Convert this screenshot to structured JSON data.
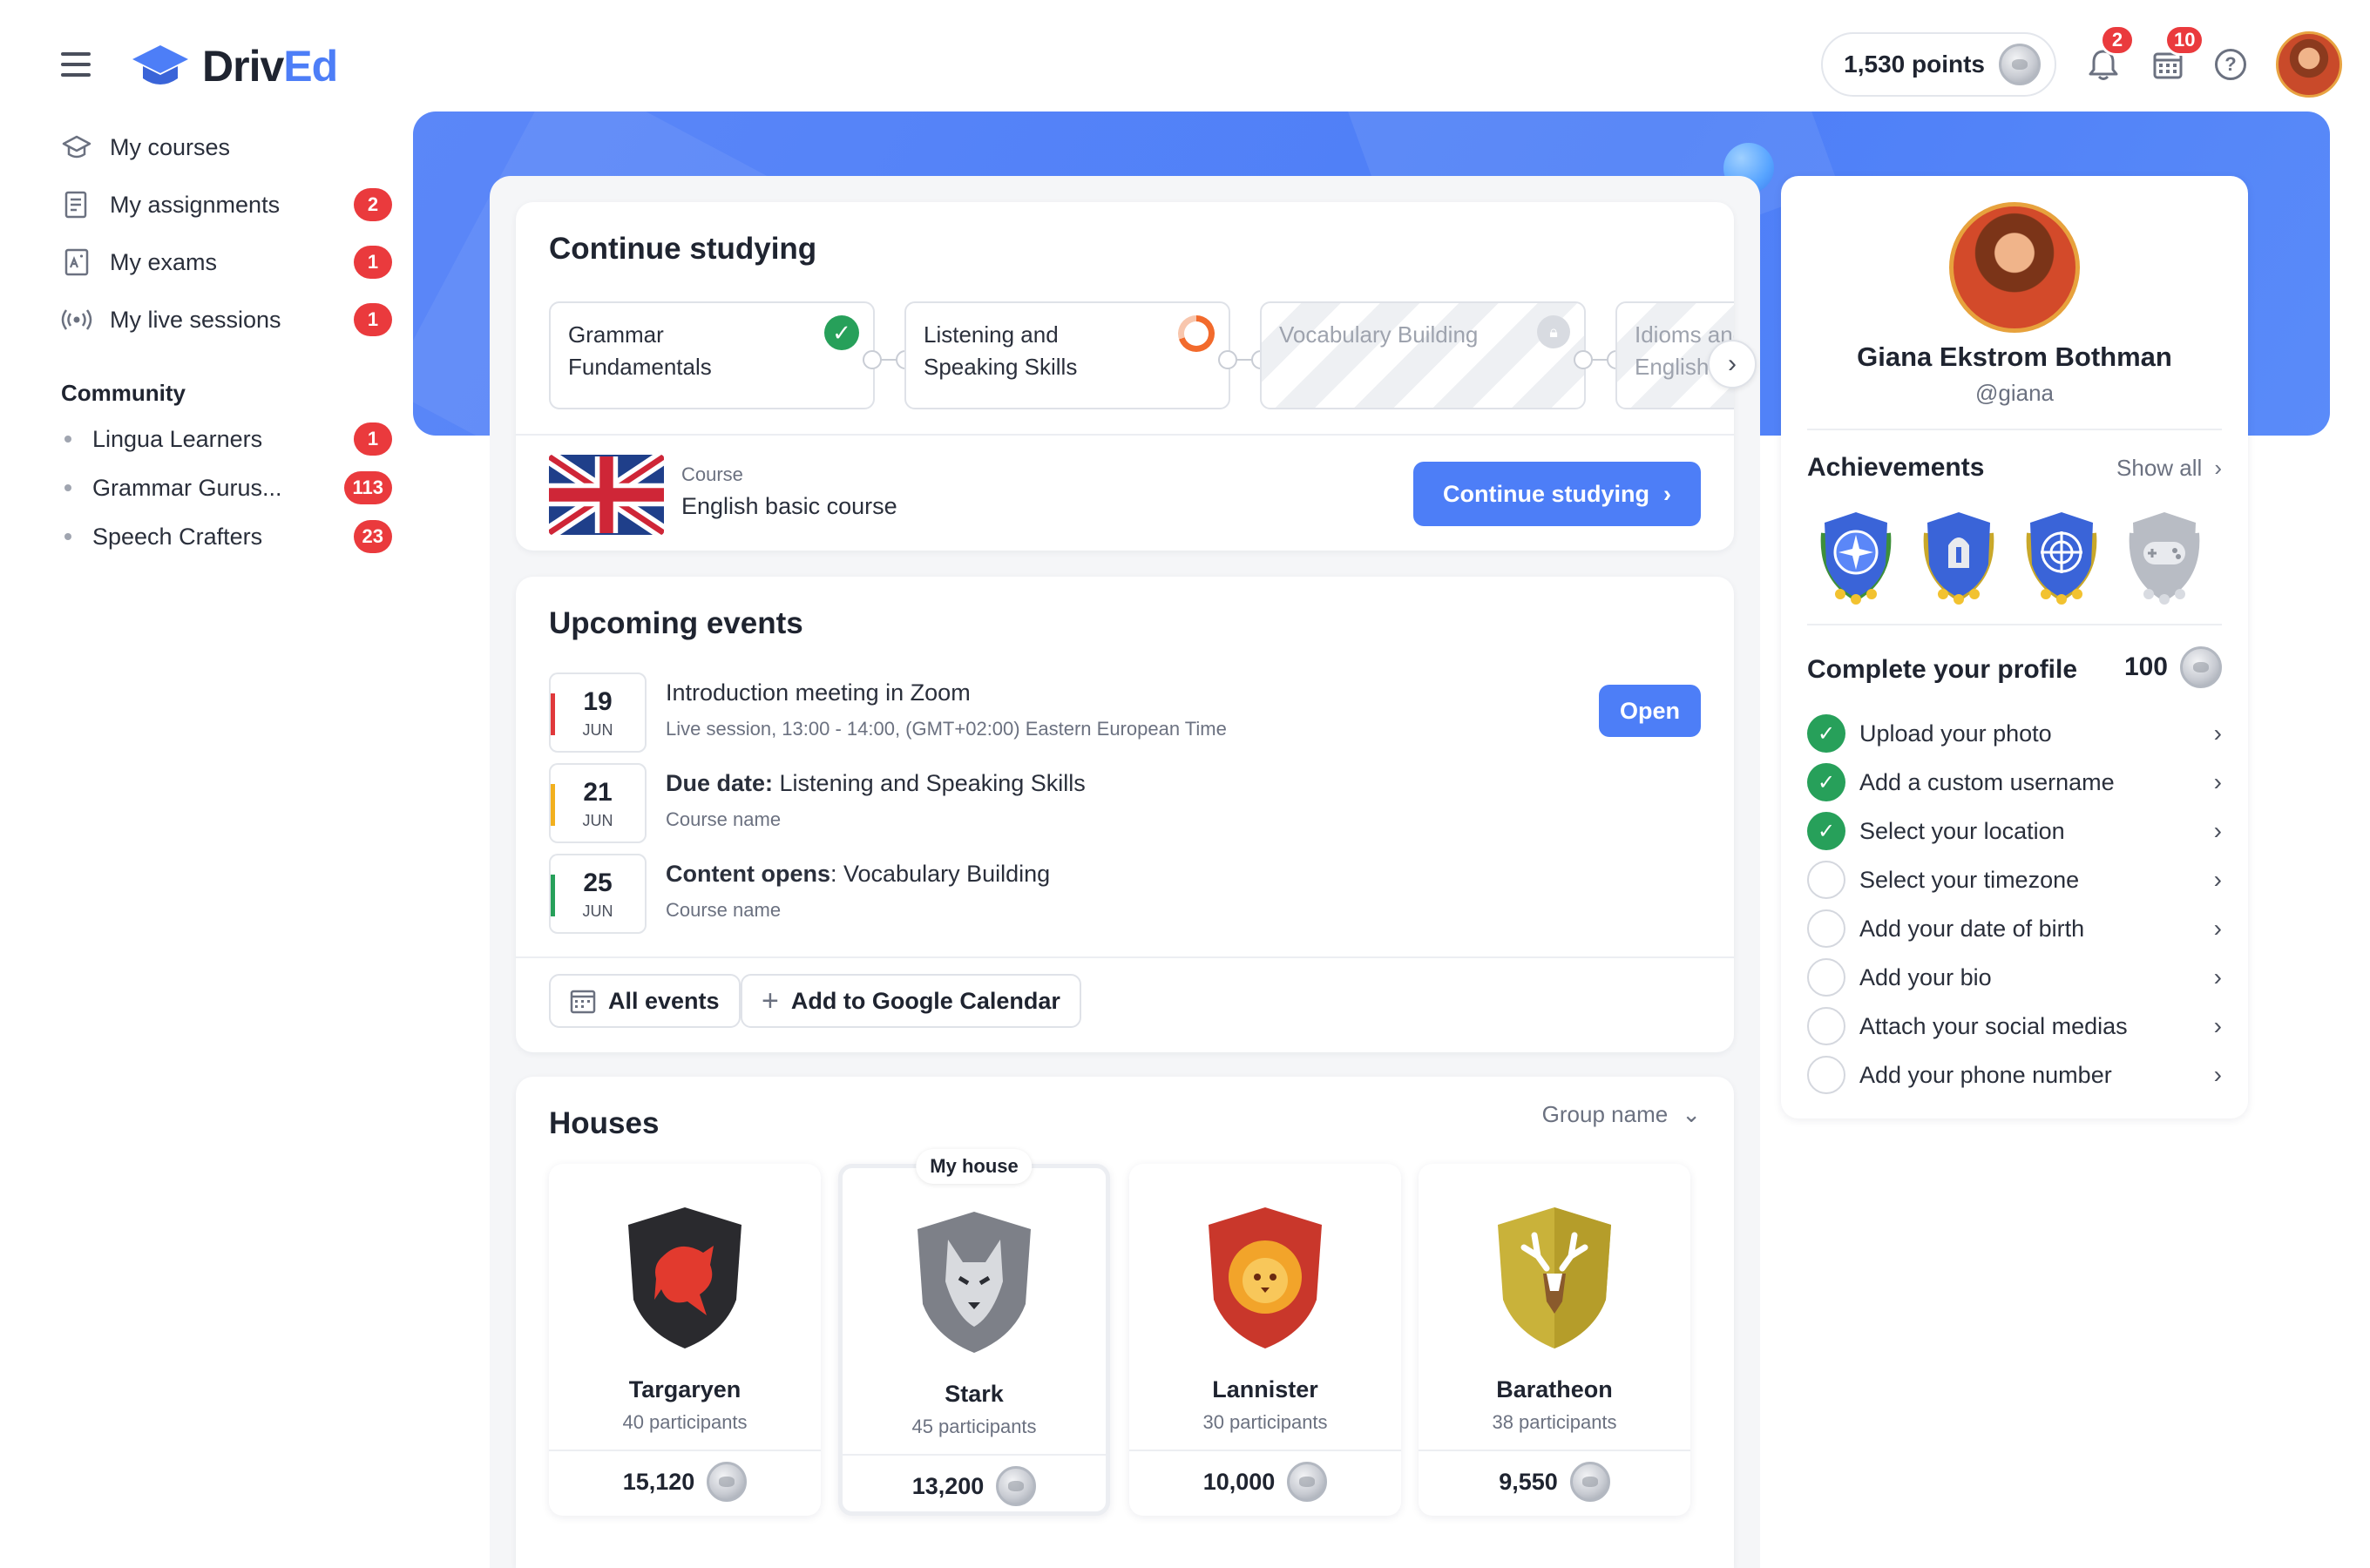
{
  "brand": {
    "name_part1": "Driv",
    "name_part2": "Ed",
    "accent_color": "#4d7ef7"
  },
  "topbar": {
    "points": "1,530 points",
    "notifications_count": "2",
    "calendar_count": "10",
    "help_symbol": "?"
  },
  "sidebar": {
    "items": [
      {
        "label": "My courses",
        "icon": "graduation-cap-icon",
        "badge": ""
      },
      {
        "label": "My assignments",
        "icon": "assignment-icon",
        "badge": "2"
      },
      {
        "label": "My exams",
        "icon": "exam-icon",
        "badge": "1"
      },
      {
        "label": "My live sessions",
        "icon": "live-broadcast-icon",
        "badge": "1"
      }
    ],
    "community_title": "Community",
    "community": [
      {
        "label": "Lingua Learners",
        "badge": "1"
      },
      {
        "label": "Grammar Gurus...",
        "badge": "113"
      },
      {
        "label": "Speech Crafters",
        "badge": "23"
      }
    ]
  },
  "continue_studying": {
    "title": "Continue studying",
    "lessons": [
      {
        "label": "Grammar Fundamentals",
        "status": "completed"
      },
      {
        "label": "Listening and Speaking Skills",
        "status": "in-progress"
      },
      {
        "label": "Vocabulary Building",
        "status": "locked"
      },
      {
        "label": "Idioms and Phrases in English",
        "status": "locked"
      }
    ],
    "course_label": "Course",
    "course_name": "English basic course",
    "button": "Continue studying"
  },
  "events": {
    "title": "Upcoming events",
    "items": [
      {
        "day": "19",
        "month": "JUN",
        "title_bold": "",
        "title": "Introduction meeting in Zoom",
        "subtitle": "Live session, 13:00 - 14:00, (GMT+02:00) Eastern European Time",
        "stripe": "#e0393b",
        "action": "Open"
      },
      {
        "day": "21",
        "month": "JUN",
        "title_bold": "Due date:",
        "title": " Listening and Speaking Skills",
        "subtitle": "Course name",
        "stripe": "#f2b01e",
        "action": ""
      },
      {
        "day": "25",
        "month": "JUN",
        "title_bold": "Content opens",
        "title": ": Vocabulary Building",
        "subtitle": "Course name",
        "stripe": "#27a05a",
        "action": ""
      }
    ],
    "all_events": "All events",
    "add_calendar": "Add to Google Calendar"
  },
  "houses": {
    "title": "Houses",
    "group_select": "Group name",
    "my_house_tag": "My house",
    "items": [
      {
        "name": "Targaryen",
        "participants": "40 participants",
        "score": "15,120",
        "mine": false,
        "color": "#2a2a2e",
        "emblem": "#e23a2e"
      },
      {
        "name": "Stark",
        "participants": "45 participants",
        "score": "13,200",
        "mine": true,
        "color": "#7d8088",
        "emblem": "#d8dade"
      },
      {
        "name": "Lannister",
        "participants": "30 participants",
        "score": "10,000",
        "mine": false,
        "color": "#c9372b",
        "emblem": "#f2a42a"
      },
      {
        "name": "Baratheon",
        "participants": "38 participants",
        "score": "9,550",
        "mine": false,
        "color": "#c9b23a",
        "emblem": "#ffffff"
      }
    ]
  },
  "profile": {
    "name": "Giana Ekstrom Bothman",
    "handle": "@giana",
    "achievements_title": "Achievements",
    "show_all": "Show all",
    "complete_title": "Complete your profile",
    "complete_points": "100",
    "tasks": [
      {
        "label": "Upload your photo",
        "done": true
      },
      {
        "label": "Add a custom username",
        "done": true
      },
      {
        "label": "Select your location",
        "done": true
      },
      {
        "label": "Select your timezone",
        "done": false
      },
      {
        "label": "Add your date of birth",
        "done": false
      },
      {
        "label": "Add your bio",
        "done": false
      },
      {
        "label": "Attach your social medias",
        "done": false
      },
      {
        "label": "Add your phone number",
        "done": false
      }
    ]
  }
}
